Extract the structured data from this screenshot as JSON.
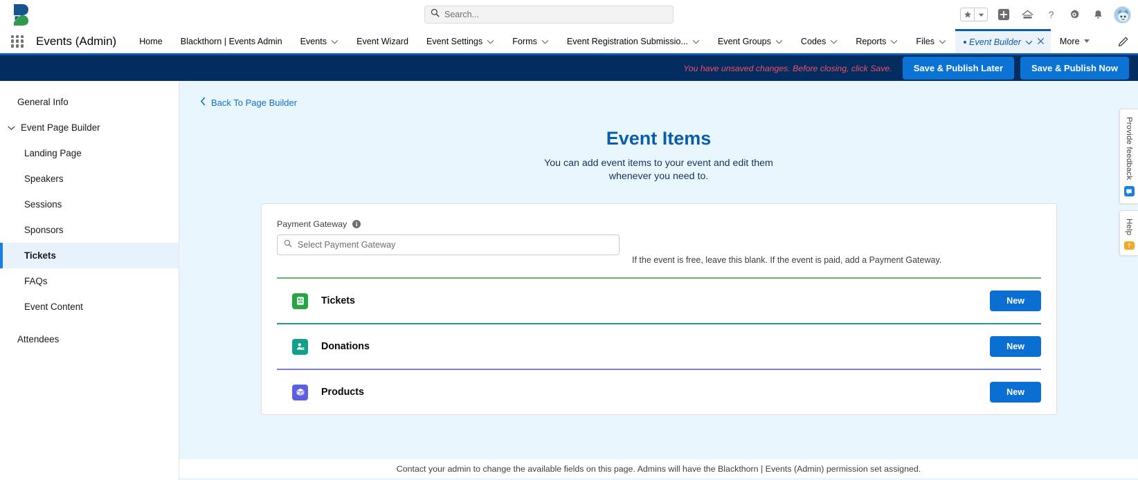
{
  "colors": {
    "brand_blue": "#0b5cab",
    "button_blue": "#0b6fd1",
    "banner_navy": "#032d60",
    "warning_red": "#f64f5e",
    "tickets_green": "#27a544",
    "donations_teal": "#13a08a",
    "products_purple": "#5c5fe0",
    "page_bg": "#eaf6fd"
  },
  "global_header": {
    "logo": "blackthorn-logo",
    "search": {
      "placeholder": "Search...",
      "value": "",
      "icon": "search-icon"
    },
    "icons": [
      {
        "name": "favorites-star-icon",
        "glyph": "star"
      },
      {
        "name": "favorites-dropdown-icon",
        "glyph": "caret-down"
      },
      {
        "name": "add-quick-action-icon",
        "glyph": "plus"
      },
      {
        "name": "app-launcher-home-icon",
        "glyph": "home"
      },
      {
        "name": "help-icon",
        "glyph": "question-mark"
      },
      {
        "name": "setup-gear-icon",
        "glyph": "gear"
      },
      {
        "name": "notifications-bell-icon",
        "glyph": "bell"
      },
      {
        "name": "user-avatar",
        "glyph": "avatar"
      }
    ]
  },
  "app_nav": {
    "waffle_icon": "app-launcher-icon",
    "app_name": "Events (Admin)",
    "items": [
      {
        "label": "Home",
        "has_menu": false,
        "active": false
      },
      {
        "label": "Blackthorn | Events Admin",
        "has_menu": false,
        "active": false
      },
      {
        "label": "Events",
        "has_menu": true,
        "active": false
      },
      {
        "label": "Event Wizard",
        "has_menu": false,
        "active": false
      },
      {
        "label": "Event Settings",
        "has_menu": true,
        "active": false
      },
      {
        "label": "Forms",
        "has_menu": true,
        "active": false
      },
      {
        "label": "Event Registration Submissio...",
        "has_menu": true,
        "active": false
      },
      {
        "label": "Event Groups",
        "has_menu": true,
        "active": false
      },
      {
        "label": "Codes",
        "has_menu": true,
        "active": false
      },
      {
        "label": "Reports",
        "has_menu": true,
        "active": false
      },
      {
        "label": "Files",
        "has_menu": true,
        "active": false
      },
      {
        "label": "Event Builder",
        "has_menu": true,
        "active": true,
        "unsaved": true,
        "closeable": true
      },
      {
        "label": "More",
        "has_menu": true,
        "active": false,
        "caret": true
      }
    ],
    "edit_icon": "pencil-edit-icon"
  },
  "banner": {
    "message": "You have unsaved changes. Before closing, click Save.",
    "save_later_label": "Save & Publish Later",
    "save_now_label": "Save & Publish Now"
  },
  "sidebar": {
    "items": [
      {
        "label": "General Info",
        "type": "top",
        "selected": false
      },
      {
        "label": "Event Page Builder",
        "type": "group",
        "selected": false,
        "expanded": true
      },
      {
        "label": "Landing Page",
        "type": "sub",
        "selected": false
      },
      {
        "label": "Speakers",
        "type": "sub",
        "selected": false
      },
      {
        "label": "Sessions",
        "type": "sub",
        "selected": false
      },
      {
        "label": "Sponsors",
        "type": "sub",
        "selected": false
      },
      {
        "label": "Tickets",
        "type": "sub",
        "selected": true
      },
      {
        "label": "FAQs",
        "type": "sub",
        "selected": false
      },
      {
        "label": "Event Content",
        "type": "sub",
        "selected": false
      },
      {
        "label": "Attendees",
        "type": "top",
        "selected": false
      }
    ]
  },
  "main": {
    "back_link": "Back To Page Builder",
    "back_icon": "chevron-left-icon",
    "title": "Event Items",
    "subtitle_line1": "You can add event items to your event and edit them",
    "subtitle_line2": "whenever you need to.",
    "payment_gateway": {
      "label": "Payment Gateway",
      "info_icon": "info-icon",
      "input_placeholder": "Select Payment Gateway",
      "input_value": "",
      "search_icon": "search-icon",
      "helper_text": "If the event is free, leave this blank. If the event is paid, add a Payment Gateway."
    },
    "item_rows": [
      {
        "label": "Tickets",
        "icon": "ticket-document-icon",
        "icon_color": "#27a544",
        "rule_color": "#63b76c",
        "button_label": "New"
      },
      {
        "label": "Donations",
        "icon": "donation-person-icon",
        "icon_color": "#13a08a",
        "rule_color": "#15a47f",
        "button_label": "New"
      },
      {
        "label": "Products",
        "icon": "product-box-icon",
        "icon_color": "#5c5fe0",
        "rule_color": "#7b7de0",
        "button_label": "New"
      }
    ],
    "footer_note": "Contact your admin to change the available fields on this page. Admins will have the Blackthorn | Events (Admin) permission set assigned."
  },
  "right_rail": {
    "tabs": [
      {
        "label": "Provide feedback",
        "badge_color": "#1b7fe0",
        "badge_icon": "feedback-icon"
      },
      {
        "label": "Help",
        "badge_color": "#f5a623",
        "badge_icon": "help-badge-icon"
      }
    ]
  }
}
